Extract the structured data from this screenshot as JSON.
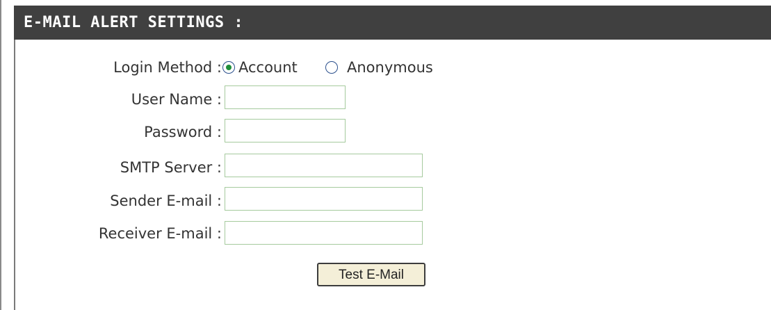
{
  "section": {
    "title": "E-MAIL ALERT SETTINGS :"
  },
  "login": {
    "label": "Login Method :",
    "options": [
      "Account",
      "Anonymous"
    ],
    "selected": "Account"
  },
  "fields": {
    "user_name": {
      "label": "User Name :",
      "value": ""
    },
    "password": {
      "label": "Password :",
      "value": ""
    },
    "smtp_server": {
      "label": "SMTP Server :",
      "value": ""
    },
    "sender_email": {
      "label": "Sender E-mail :",
      "value": ""
    },
    "receiver_email": {
      "label": "Receiver E-mail :",
      "value": ""
    }
  },
  "actions": {
    "test_label": "Test E-Mail"
  },
  "colors": {
    "header_bg": "#404040",
    "input_border": "#a5ca9d",
    "button_bg": "#f4efd8",
    "radio_dot": "#1f8f3a"
  }
}
